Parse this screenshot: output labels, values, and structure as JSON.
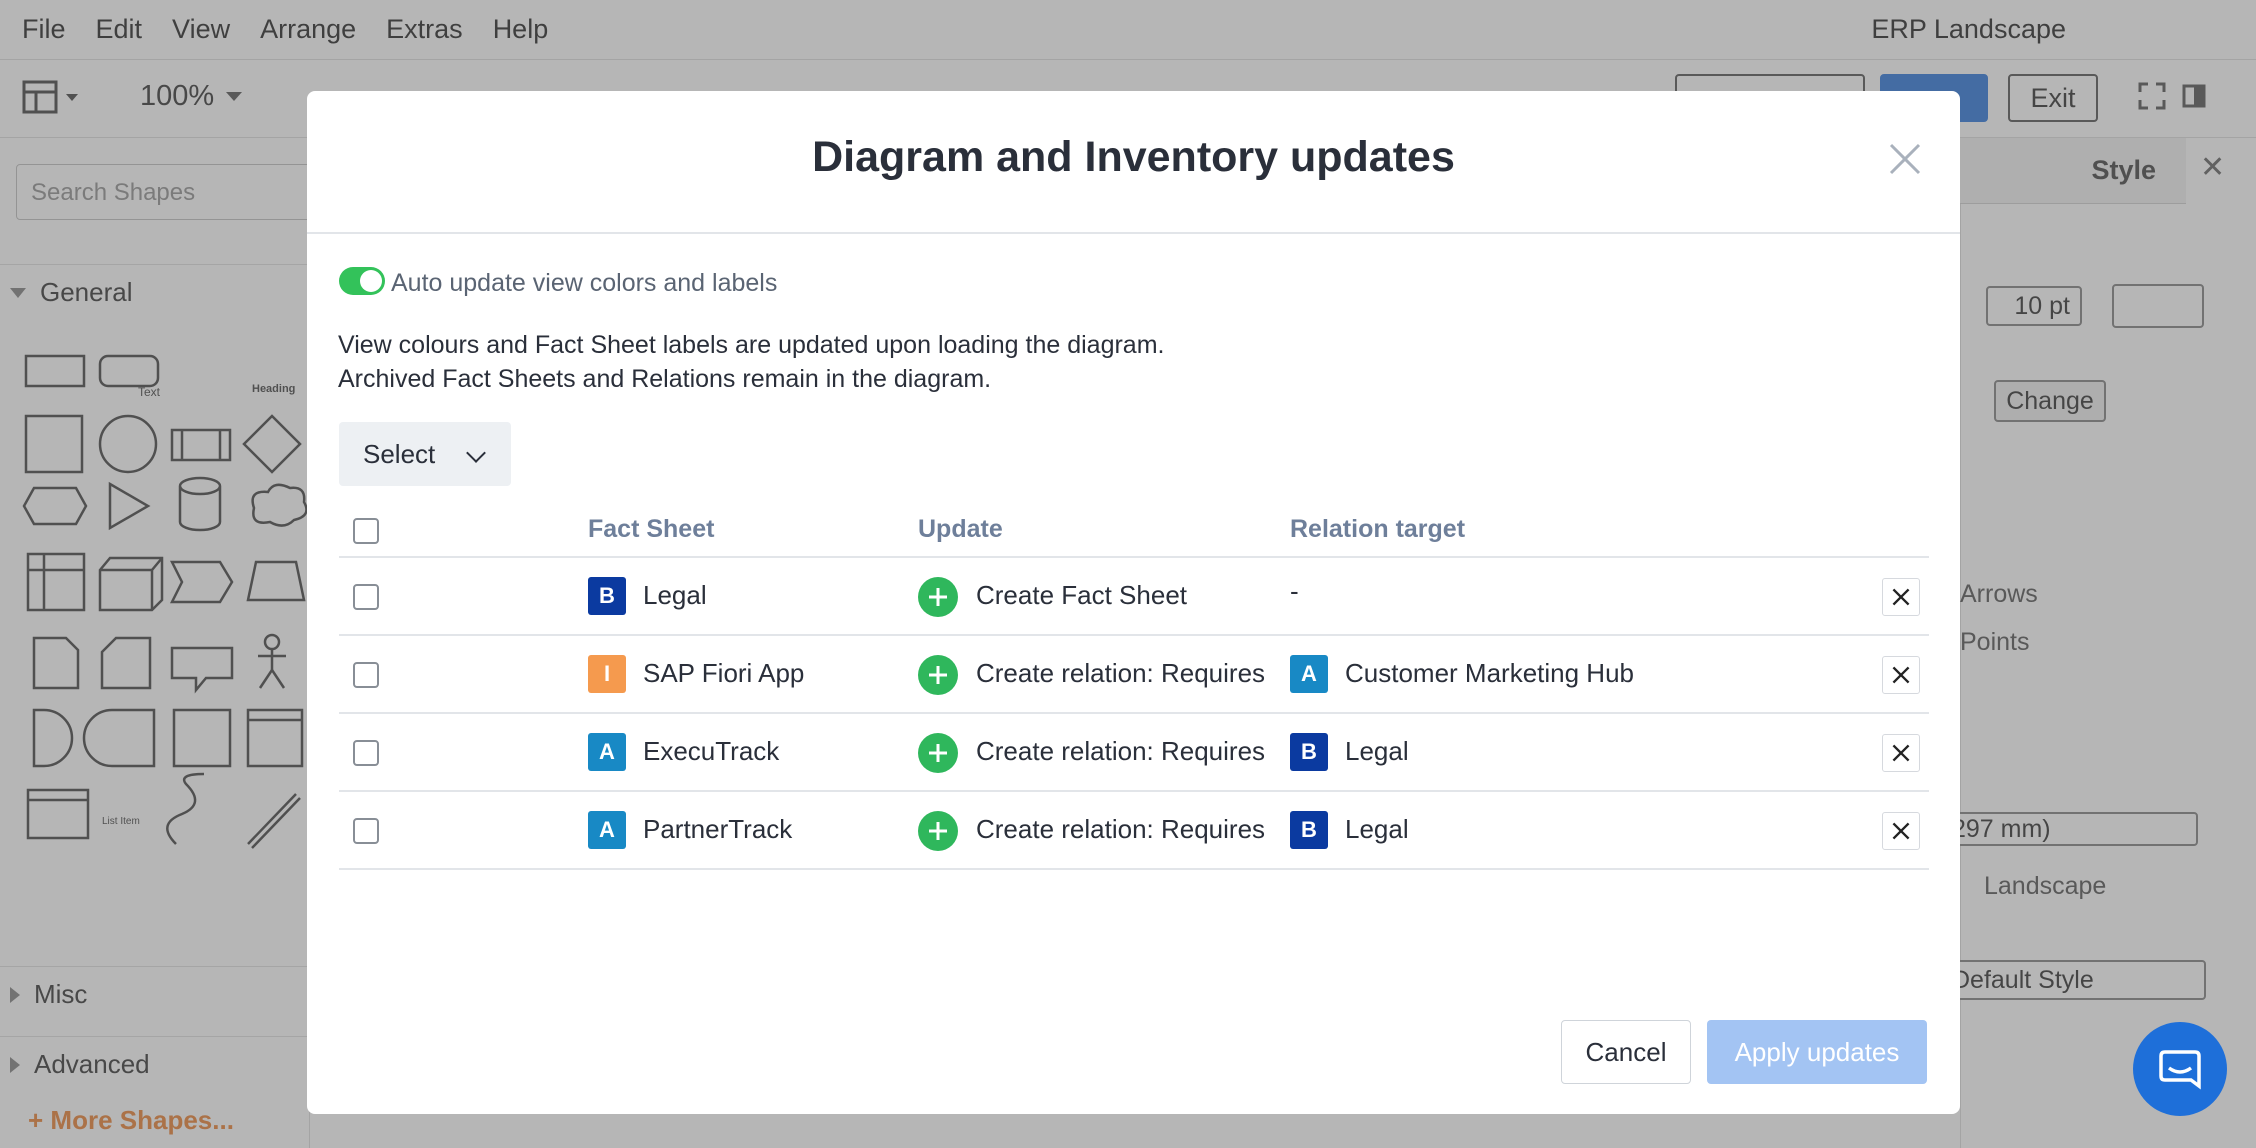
{
  "menubar": {
    "items": [
      "File",
      "Edit",
      "View",
      "Arrange",
      "Extras",
      "Help"
    ],
    "document_title": "ERP Landscape"
  },
  "toolbar": {
    "zoom": "100%",
    "exit_label": "Exit"
  },
  "left_panel": {
    "search_placeholder": "Search Shapes",
    "section_general": "General",
    "section_misc": "Misc",
    "section_advanced": "Advanced",
    "more_shapes": "More Shapes..."
  },
  "right_panel": {
    "tab_style": "Style",
    "size_value": "10 pt",
    "change_label": "Change",
    "arrows_label": "Arrows",
    "points_label": "Points",
    "paper_value": "297 mm)",
    "landscape_label": "Landscape",
    "default_style_label": "Default Style"
  },
  "modal": {
    "title": "Diagram and Inventory updates",
    "auto_update_label": "Auto update view colors and labels",
    "auto_update_on": true,
    "description_line1": "View colours and Fact Sheet labels are updated upon loading the diagram.",
    "description_line2": "Archived Fact Sheets and Relations remain in the diagram.",
    "select_label": "Select",
    "columns": {
      "fact_sheet": "Fact Sheet",
      "update": "Update",
      "relation_target": "Relation target"
    },
    "rows": [
      {
        "badge": "B",
        "badge_color": "#0b3aa0",
        "name": "Legal",
        "update": "Create Fact Sheet",
        "target_badge": "",
        "target_badge_color": "",
        "target": "-"
      },
      {
        "badge": "I",
        "badge_color": "#f59a4e",
        "name": "SAP Fiori App",
        "update": "Create relation: Requires",
        "target_badge": "A",
        "target_badge_color": "#1889c5",
        "target": "Customer Marketing Hub"
      },
      {
        "badge": "A",
        "badge_color": "#1889c5",
        "name": "ExecuTrack",
        "update": "Create relation: Requires",
        "target_badge": "B",
        "target_badge_color": "#0b3aa0",
        "target": "Legal"
      },
      {
        "badge": "A",
        "badge_color": "#1889c5",
        "name": "PartnerTrack",
        "update": "Create relation: Requires",
        "target_badge": "B",
        "target_badge_color": "#0b3aa0",
        "target": "Legal"
      }
    ],
    "cancel_label": "Cancel",
    "apply_label": "Apply updates"
  },
  "icons": {
    "close": "close-icon",
    "row_remove": "close-icon",
    "update_add": "plus-circle-icon",
    "chat": "chat-icon"
  }
}
